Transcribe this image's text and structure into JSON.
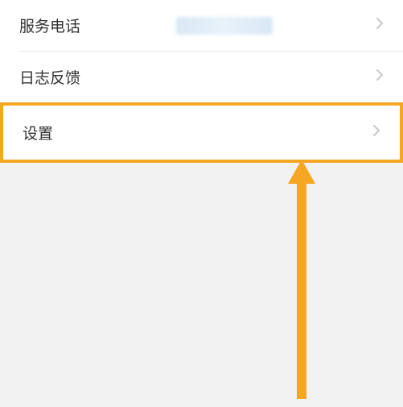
{
  "rows": {
    "service_phone": {
      "label": "服务电话"
    },
    "log_feedback": {
      "label": "日志反馈"
    },
    "settings": {
      "label": "设置"
    }
  },
  "colors": {
    "highlight": "#f5a623",
    "chevron": "#c7c7cc"
  }
}
